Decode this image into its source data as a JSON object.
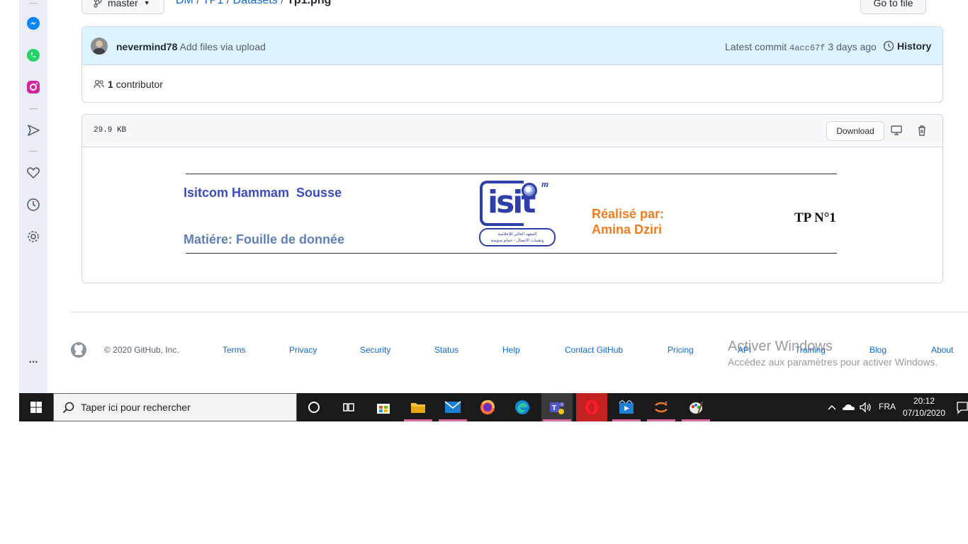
{
  "repo": {
    "branch": "master",
    "breadcrumb": [
      "DM",
      "TP1",
      "Datasets"
    ],
    "breadcrumb_sep": "/",
    "file_name": "Tp1.png",
    "go_to_file": "Go to file",
    "more": "···"
  },
  "commit": {
    "author": "nevermind78",
    "message": "Add files via upload",
    "latest_label": "Latest commit",
    "hash": "4acc67f",
    "age": "3 days ago",
    "history": "History"
  },
  "contributors": {
    "count": "1",
    "label": "contributor"
  },
  "file": {
    "size": "29.9 KB",
    "download": "Download"
  },
  "preview": {
    "school": "Isitcom Hammam  Sousse",
    "subject": "Matiére: Fouille de donnée",
    "made_by": "Réalisé par:",
    "author": "Amina Dziri",
    "tp": "TP N°1",
    "logo_text": "isit",
    "logo_sup": "m",
    "logo_arabic_1": "المعهد العالي للإعلامية",
    "logo_arabic_2": "وتقنيات الاتصال - حمام سوسة"
  },
  "footer": {
    "copyright": "© 2020 GitHub, Inc.",
    "links": [
      "Terms",
      "Privacy",
      "Security",
      "Status",
      "Help",
      "Contact GitHub",
      "Pricing",
      "API",
      "Training",
      "Blog",
      "About"
    ]
  },
  "watermark": {
    "title": "Activer Windows",
    "subtitle": "Accédez aux paramètres pour activer Windows."
  },
  "sidebar": {
    "icons": [
      "messenger-icon",
      "whatsapp-icon",
      "instagram-icon",
      "send-icon",
      "heart-icon",
      "history-icon",
      "settings-icon"
    ],
    "more": "···"
  },
  "taskbar": {
    "search_placeholder": "Taper ici pour rechercher",
    "lang": "FRA",
    "time": "20:12",
    "date": "07/10/2020",
    "apps": [
      "cortana-icon",
      "task-view-icon",
      "store-icon",
      "file-explorer-icon",
      "mail-icon",
      "firefox-icon",
      "edge-icon",
      "teams-icon",
      "opera-icon",
      "video-editor-icon",
      "jupyter-icon",
      "paint-icon"
    ]
  },
  "colors": {
    "link": "#0969da",
    "school_blue": "#3b4cc0",
    "subject_blue": "#5f80b7",
    "orange": "#ef7d22",
    "taskbar": "#1a1a1a"
  }
}
